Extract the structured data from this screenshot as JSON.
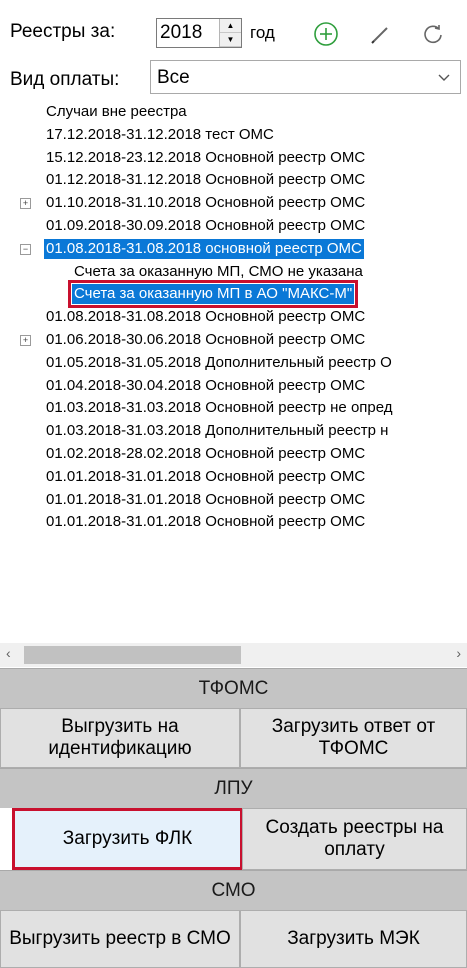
{
  "toolbar": {
    "year_label": "Реестры за:",
    "year_value": "2018",
    "year_suffix": "год",
    "icons": [
      "add-icon",
      "pencil-icon",
      "refresh-icon"
    ]
  },
  "payment": {
    "label": "Вид оплаты:",
    "value": "Все"
  },
  "tree": {
    "items": [
      {
        "label": "Случаи вне реестра"
      },
      {
        "label": "17.12.2018-31.12.2018 тест ОМС"
      },
      {
        "label": "15.12.2018-23.12.2018 Основной реестр ОМС"
      },
      {
        "label": "01.12.2018-31.12.2018 Основной реестр ОМС"
      },
      {
        "label": "01.10.2018-31.10.2018 Основной реестр ОМС",
        "expander": "+"
      },
      {
        "label": "01.09.2018-30.09.2018 Основной реестр ОМС"
      },
      {
        "label": "01.08.2018-31.08.2018 основной реестр ОМС",
        "expander": "−",
        "selected": true
      },
      {
        "label": "Счета за оказанную МП, СМО не указана",
        "child": true
      },
      {
        "label": "Счета за оказанную МП в АО \"МАКС-М\"",
        "child": true,
        "selected": true,
        "outlined": true
      },
      {
        "label": "01.08.2018-31.08.2018 Основной реестр ОМС"
      },
      {
        "label": "01.06.2018-30.06.2018 Основной реестр ОМС",
        "expander": "+"
      },
      {
        "label": "01.05.2018-31.05.2018 Дополнительный реестр О"
      },
      {
        "label": "01.04.2018-30.04.2018 Основной реестр ОМС"
      },
      {
        "label": "01.03.2018-31.03.2018 Основной реестр не опред"
      },
      {
        "label": "01.03.2018-31.03.2018 Дополнительный реестр н"
      },
      {
        "label": "01.02.2018-28.02.2018 Основной реестр ОМС"
      },
      {
        "label": "01.01.2018-31.01.2018 Основной реестр ОМС"
      },
      {
        "label": "01.01.2018-31.01.2018 Основной реестр ОМС"
      },
      {
        "label": "01.01.2018-31.01.2018 Основной реестр ОМС"
      }
    ]
  },
  "scrollbar": {
    "left_arrow": "‹",
    "right_arrow": "›"
  },
  "sections": {
    "tfoms": {
      "title": "ТФОМС",
      "btn_left": "Выгрузить на идентификацию",
      "btn_right": "Загрузить ответ от ТФОМС"
    },
    "lpu": {
      "title": "ЛПУ",
      "btn_left": "Загрузить ФЛК",
      "btn_right": "Создать реестры на оплату"
    },
    "smo": {
      "title": "СМО",
      "btn_left": "Выгрузить реестр в СМО",
      "btn_right": "Загрузить МЭК"
    }
  },
  "colors": {
    "selection": "#0a78d7",
    "highlight_outline": "#c8102e",
    "add_icon": "#2e9e3c"
  }
}
